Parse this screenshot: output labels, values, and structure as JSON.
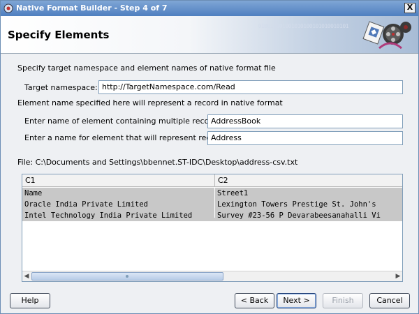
{
  "window": {
    "title": "Native Format Builder - Step 4 of 7",
    "close_label": "X"
  },
  "banner": {
    "title": "Specify Elements",
    "binary_text": "010010101001010100101010010101"
  },
  "form": {
    "intro": "Specify target namespace and element names of native format file",
    "target_namespace_label": "Target namespace:",
    "target_namespace_value": "http://TargetNamespace.com/Read",
    "record_note": "Element name specified here will represent a record in native format",
    "multiple_records_label": "Enter name of element containing multiple records:",
    "multiple_records_value": "AddressBook",
    "record_element_label": "Enter a name for element that will represent record:",
    "record_element_value": "Address"
  },
  "file": {
    "path_label": "File: C:\\Documents and Settings\\bbennet.ST-IDC\\Desktop\\address-csv.txt"
  },
  "grid": {
    "columns": [
      "C1",
      "C2"
    ],
    "rows": [
      [
        "Name",
        "Street1"
      ],
      [
        "Oracle India Private Limited",
        " Lexington Towers Prestige St. John's"
      ],
      [
        "Intel Technology India Private Limited",
        " Survey #23-56 P Devarabeesanahalli Vi"
      ]
    ]
  },
  "buttons": {
    "help": "Help",
    "back": "< Back",
    "next": "Next >",
    "finish": "Finish",
    "cancel": "Cancel"
  },
  "colors": {
    "title_bar": "#4f7fc0",
    "selected_row": "#c8c8c8",
    "field_border": "#7f9db9"
  },
  "icons": {
    "app": "oracle-app-icon",
    "wizard": "film-reel-gear-icon"
  }
}
